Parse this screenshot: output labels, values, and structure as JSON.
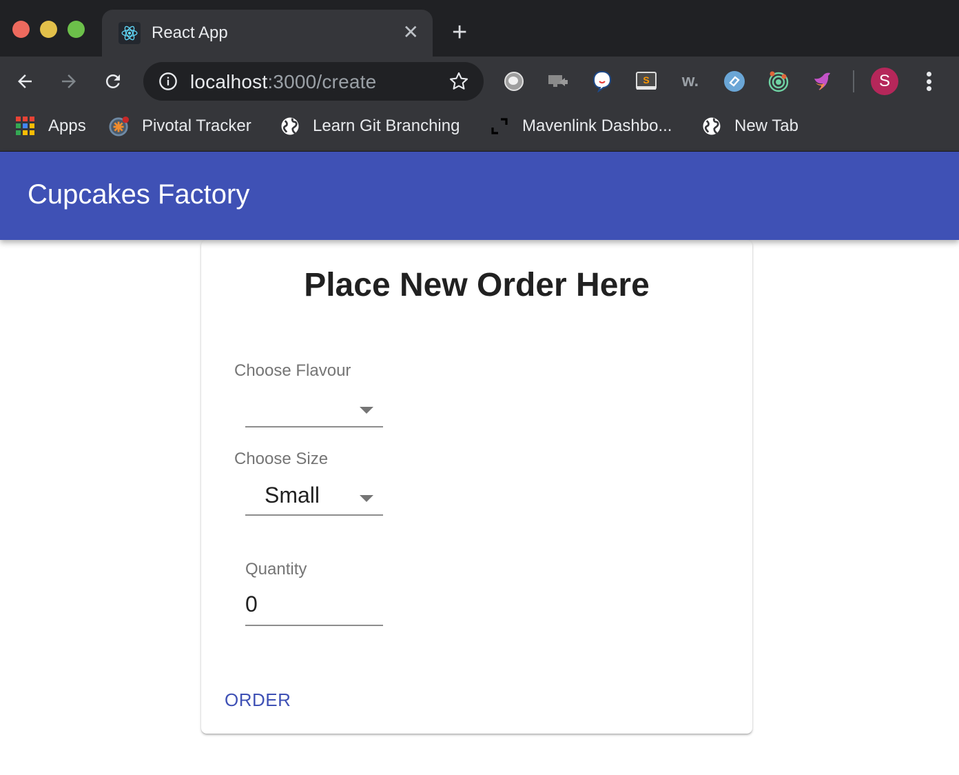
{
  "browser": {
    "tab": {
      "title": "React App",
      "favicon": "react-icon",
      "close_icon": "close-icon"
    },
    "new_tab_icon": "plus-icon",
    "nav": {
      "back_icon": "arrow-left-icon",
      "forward_icon": "arrow-right-icon",
      "reload_icon": "reload-icon"
    },
    "omnibox": {
      "host": "localhost",
      "rest": ":3000/create",
      "info_icon": "info-icon",
      "star_icon": "star-icon"
    },
    "extensions": [
      {
        "name": "circle-extension-icon"
      },
      {
        "name": "screen-share-extension-icon"
      },
      {
        "name": "chat-bubble-extension-icon"
      },
      {
        "name": "sublime-extension-icon"
      },
      {
        "name": "w-extension-icon",
        "text": "w."
      },
      {
        "name": "blue-circle-extension-icon"
      },
      {
        "name": "target-extension-icon"
      },
      {
        "name": "bird-extension-icon"
      }
    ],
    "profile": {
      "initial": "S",
      "color": "#b5275a"
    },
    "menu_icon": "more-vert-icon",
    "bookmarks": [
      {
        "label": "Apps",
        "icon": "apps-grid-icon"
      },
      {
        "label": "Pivotal Tracker",
        "icon": "pivotal-tracker-icon"
      },
      {
        "label": "Learn Git Branching",
        "icon": "globe-icon"
      },
      {
        "label": "Mavenlink Dashbo...",
        "icon": "mavenlink-icon"
      },
      {
        "label": "New Tab",
        "icon": "globe-icon"
      }
    ]
  },
  "app": {
    "title": "Cupcakes Factory",
    "brand_color": "#3f51b5"
  },
  "form": {
    "title": "Place New Order Here",
    "flavour": {
      "label": "Choose Flavour",
      "value": ""
    },
    "size": {
      "label": "Choose Size",
      "value": "Small"
    },
    "quantity": {
      "label": "Quantity",
      "value": "0"
    },
    "submit_label": "ORDER"
  }
}
